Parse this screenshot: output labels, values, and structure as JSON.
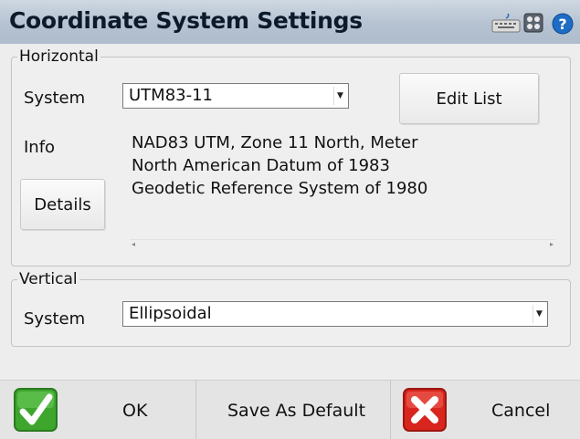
{
  "window": {
    "title": "Coordinate System Settings",
    "icons": [
      "keyboard-icon",
      "calculator-icon",
      "help-icon"
    ]
  },
  "horizontal": {
    "legend": "Horizontal",
    "system_label": "System",
    "system_value": "UTM83-11",
    "edit_list_label": "Edit List",
    "info_label": "Info",
    "info_lines": [
      "NAD83 UTM, Zone 11 North, Meter",
      "North American Datum of 1983",
      "Geodetic Reference System of 1980"
    ],
    "details_label": "Details"
  },
  "vertical": {
    "legend": "Vertical",
    "system_label": "System",
    "system_value": "Ellipsoidal"
  },
  "footer": {
    "ok_label": "OK",
    "save_default_label": "Save As Default",
    "cancel_label": "Cancel"
  },
  "colors": {
    "title_bar": "#b5c2d1",
    "ok_green": "#3ea52d",
    "cancel_red": "#d8251d"
  }
}
